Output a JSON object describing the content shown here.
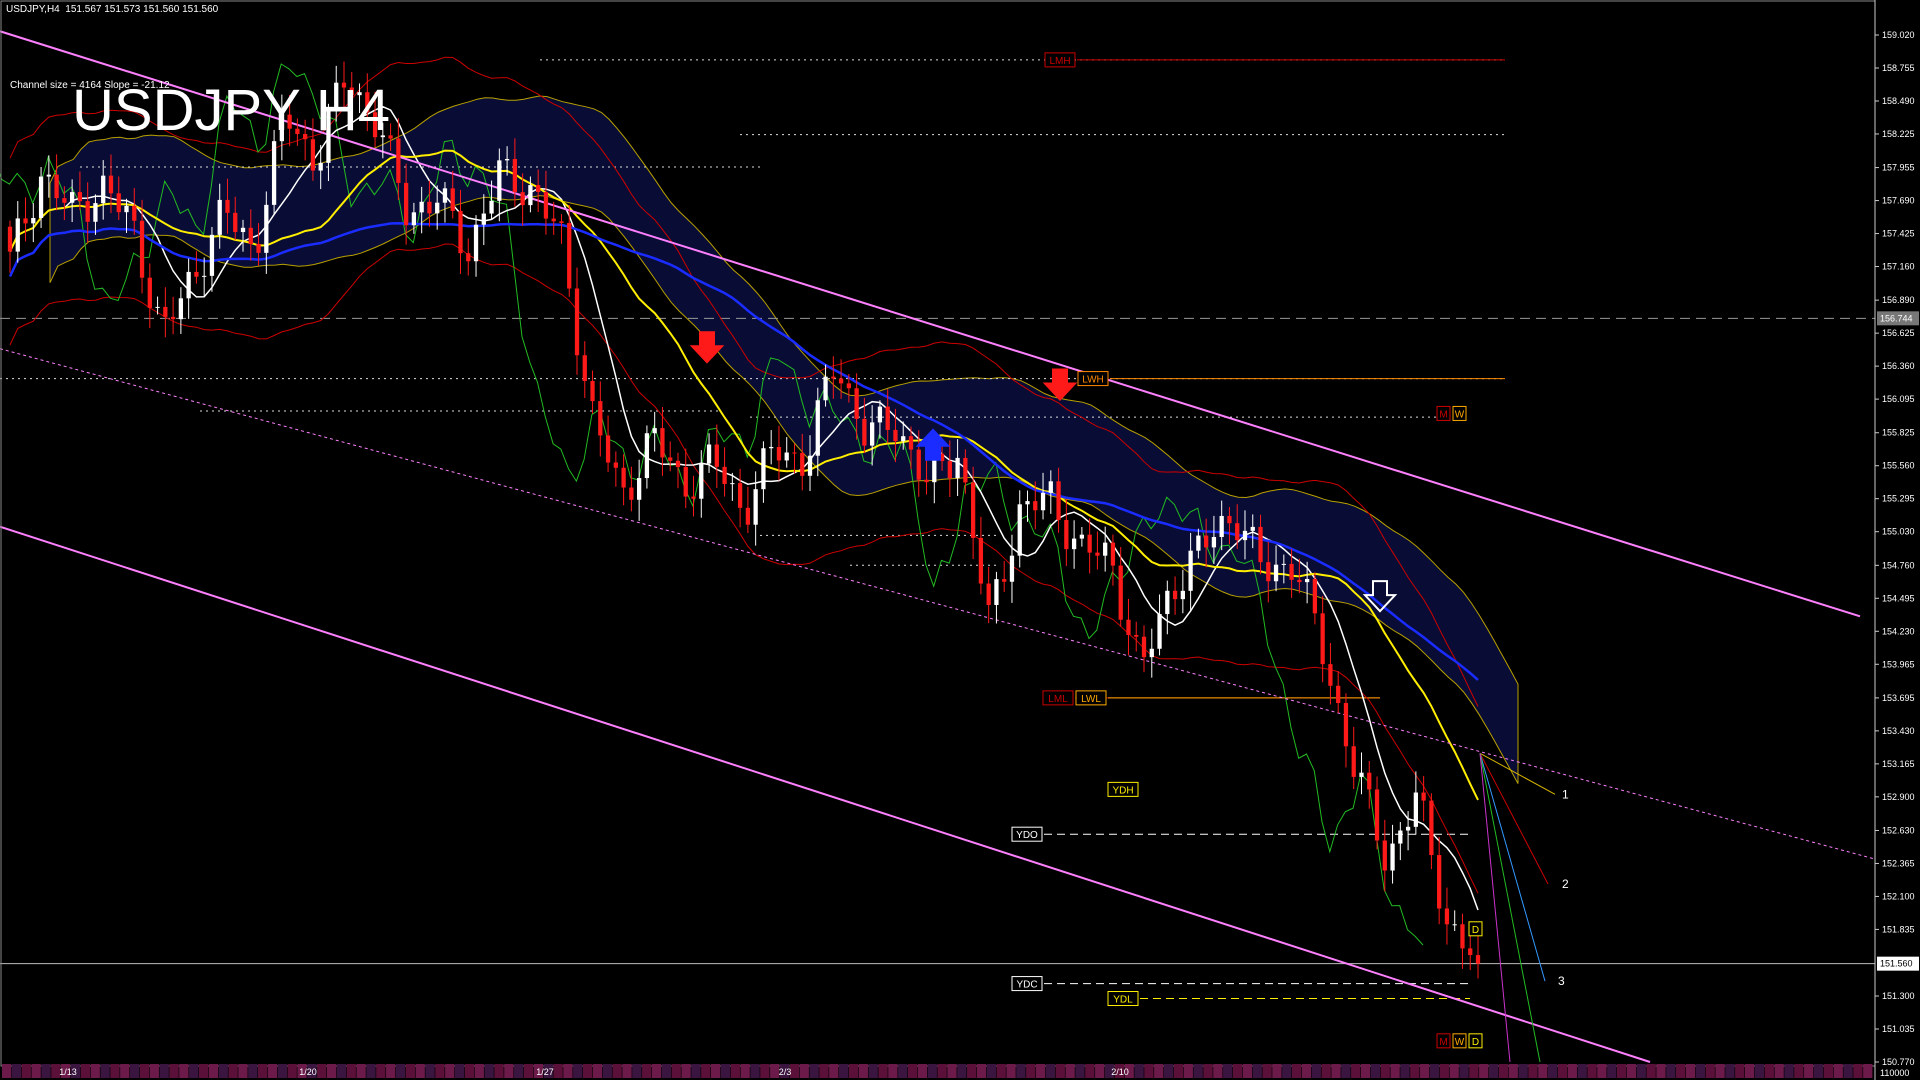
{
  "header": {
    "symbol_tf": "USDJPY,H4",
    "ohlc": "151.567 151.573 151.560 151.560"
  },
  "channel_info": "Channel size = 4164 Slope = -21.12",
  "title": "USDJPY H4",
  "colors": {
    "background": "#000000",
    "bull_candle": "#ffffff",
    "bear_candle": "#ff1a1a",
    "ma_white": "#ffffff",
    "ma_yellow": "#ffee00",
    "ma_blue": "#1a2cff",
    "channel": "#ff80ff",
    "bollinger": "#cc0000",
    "ichimoku_cloud": "#2030c0",
    "chikou": "#22bb22",
    "level_line": "#ffffff"
  },
  "chart_data": {
    "type": "candlestick",
    "title": "USDJPY H4",
    "symbol": "USDJPY",
    "timeframe": "H4",
    "ylim": [
      150.77,
      159.02
    ],
    "y_ticks": [
      "159.020",
      "158.755",
      "158.490",
      "158.225",
      "157.955",
      "157.690",
      "157.425",
      "157.160",
      "156.890",
      "156.625",
      "156.360",
      "156.095",
      "155.825",
      "155.560",
      "155.295",
      "155.030",
      "154.760",
      "154.495",
      "154.230",
      "153.965",
      "153.695",
      "153.430",
      "153.165",
      "152.900",
      "152.630",
      "152.365",
      "152.100",
      "151.835",
      "151.300",
      "151.035",
      "150.770"
    ],
    "x_ticks": [
      "1/13",
      "1/20",
      "1/27",
      "2/3",
      "2/10"
    ],
    "current_price": "151.560",
    "marked_price": "156.744",
    "bottom_label": "110000",
    "close_path": [
      157.2,
      157.9,
      157.6,
      157.8,
      157.5,
      156.6,
      157.1,
      157.6,
      157.3,
      158.4,
      158.0,
      158.7,
      158.3,
      157.6,
      157.7,
      157.3,
      157.9,
      157.8,
      157.4,
      156.0,
      155.3,
      155.8,
      155.4,
      155.6,
      155.2,
      155.7,
      155.6,
      156.4,
      155.8,
      155.9,
      155.4,
      155.7,
      154.3,
      155.2,
      155.3,
      154.9,
      154.8,
      153.9,
      154.6,
      154.9,
      155.2,
      154.7,
      154.8,
      154.0,
      153.1,
      152.4,
      152.9,
      151.9,
      151.56
    ],
    "levels": [
      {
        "label": "LMH",
        "price": 158.82,
        "color": "#cc0000"
      },
      {
        "label": "LWH",
        "price": 156.26,
        "color": "#ff8800"
      },
      {
        "label": "LML",
        "price": 153.695,
        "color": "#cc0000"
      },
      {
        "label": "LWL",
        "price": 153.695,
        "color": "#ffaa00"
      },
      {
        "label": "YDH",
        "price": 152.96,
        "color": "#ffee00"
      },
      {
        "label": "YDO",
        "price": 152.6,
        "color": "#ffffff"
      },
      {
        "label": "YDC",
        "price": 151.4,
        "color": "#ffffff"
      },
      {
        "label": "YDL",
        "price": 151.28,
        "color": "#ffee00"
      }
    ],
    "projection_labels": [
      "1",
      "2",
      "3"
    ],
    "period_marks": [
      "M",
      "W",
      "D"
    ]
  }
}
